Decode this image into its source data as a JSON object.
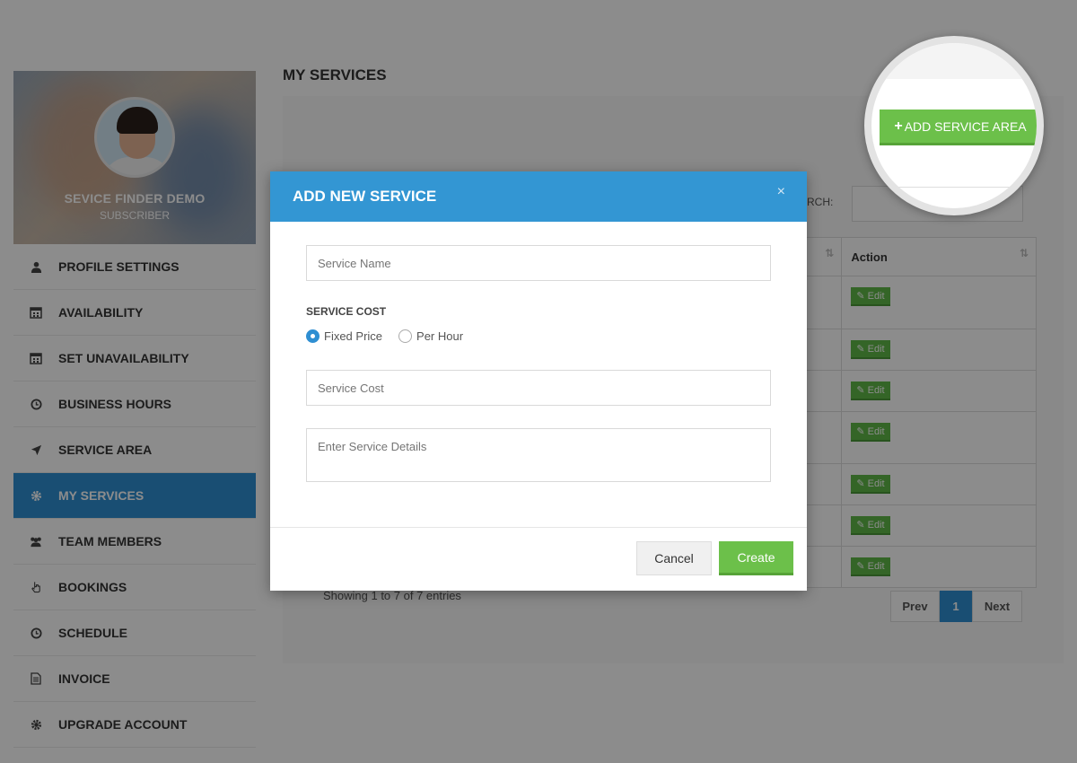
{
  "profile": {
    "name": "SEVICE FINDER DEMO",
    "role": "SUBSCRIBER"
  },
  "sidebar": {
    "items": [
      {
        "label": "PROFILE SETTINGS",
        "icon": "user-icon"
      },
      {
        "label": "AVAILABILITY",
        "icon": "calendar-icon"
      },
      {
        "label": "SET UNAVAILABILITY",
        "icon": "calendar-icon"
      },
      {
        "label": "BUSINESS HOURS",
        "icon": "clock-icon"
      },
      {
        "label": "SERVICE AREA",
        "icon": "location-arrow-icon"
      },
      {
        "label": "MY SERVICES",
        "icon": "gear-icon",
        "active": true
      },
      {
        "label": "TEAM MEMBERS",
        "icon": "users-icon"
      },
      {
        "label": "BOOKINGS",
        "icon": "hand-pointer-icon"
      },
      {
        "label": "SCHEDULE",
        "icon": "clock-icon"
      },
      {
        "label": "INVOICE",
        "icon": "document-icon"
      },
      {
        "label": "UPGRADE ACCOUNT",
        "icon": "gear-icon"
      }
    ]
  },
  "main": {
    "page_title": "MY SERVICES",
    "add_service_area_label": "ADD SERVICE AREA",
    "search_label": "EARCH:",
    "table": {
      "action_header": "Action",
      "edit_label": "Edit",
      "row_count": 7
    },
    "showing_text": "Showing 1 to 7 of 7 entries",
    "pagination": {
      "prev": "Prev",
      "current": "1",
      "next": "Next"
    }
  },
  "modal": {
    "title": "ADD NEW SERVICE",
    "close_symbol": "×",
    "service_name_placeholder": "Service Name",
    "service_cost_label": "SERVICE COST",
    "radio_fixed": "Fixed Price",
    "radio_hourly": "Per Hour",
    "selected_cost_type": "Fixed Price",
    "service_cost_placeholder": "Service Cost",
    "details_placeholder": "Enter Service Details",
    "cancel_label": "Cancel",
    "create_label": "Create"
  },
  "colors": {
    "primary_blue": "#3396d3",
    "green": "#6cc04a",
    "edit_green": "#5fb848"
  }
}
